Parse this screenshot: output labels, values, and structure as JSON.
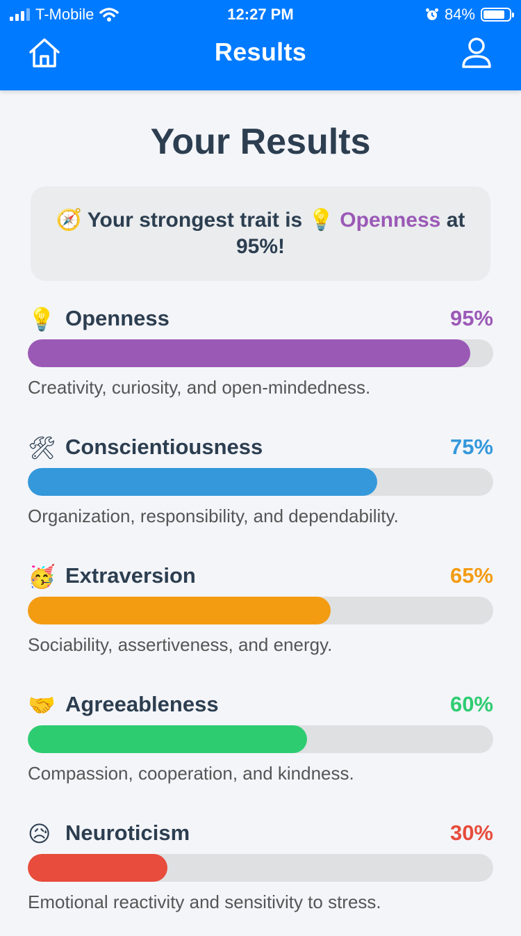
{
  "status_bar": {
    "carrier": "T-Mobile",
    "time": "12:27 PM",
    "battery": "84%",
    "battery_level": 0.84
  },
  "nav": {
    "title": "Results"
  },
  "page": {
    "title": "Your Results"
  },
  "summary": {
    "prefix": "Your strongest trait is",
    "trait": "Openness",
    "suffix": "at 95%!"
  },
  "traits": [
    {
      "name": "Openness",
      "percent_label": "95%",
      "value": 95,
      "color": "#9b59b6",
      "icon": "lightbulb-icon",
      "description": "Creativity, curiosity, and open-mindedness."
    },
    {
      "name": "Conscientiousness",
      "percent_label": "75%",
      "value": 75,
      "color": "#3498db",
      "icon": "hammer-wrench-icon",
      "description": "Organization, responsibility, and dependability."
    },
    {
      "name": "Extraversion",
      "percent_label": "65%",
      "value": 65,
      "color": "#f39c12",
      "icon": "party-face-icon",
      "description": "Sociability, assertiveness, and energy."
    },
    {
      "name": "Agreeableness",
      "percent_label": "60%",
      "value": 60,
      "color": "#2ecc71",
      "icon": "handshake-icon",
      "description": "Compassion, cooperation, and kindness."
    },
    {
      "name": "Neuroticism",
      "percent_label": "30%",
      "value": 30,
      "color": "#e74c3c",
      "icon": "anxious-face-icon",
      "description": "Emotional reactivity and sensitivity to stress."
    }
  ]
}
